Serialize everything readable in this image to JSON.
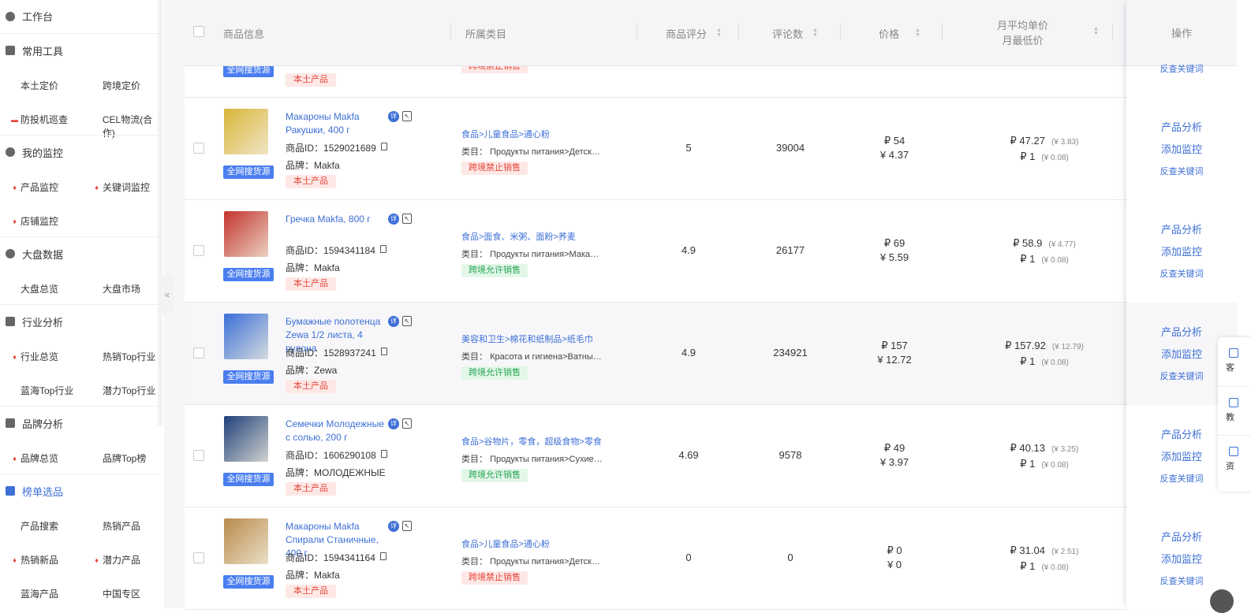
{
  "sidebar": {
    "sections": [
      {
        "label": "工作台",
        "icon": "home-icon",
        "subs": []
      },
      {
        "label": "常用工具",
        "icon": "grid-icon",
        "subs": [
          {
            "label": "本土定价",
            "hot": false
          },
          {
            "label": "跨境定价",
            "hot": false
          },
          {
            "label": "防投机巡查",
            "hot": false,
            "flag": true
          },
          {
            "label": "CEL物流(合作)",
            "hot": false
          }
        ]
      },
      {
        "label": "我的监控",
        "icon": "monitor-icon",
        "subs": [
          {
            "label": "产品监控",
            "hot": true
          },
          {
            "label": "关键词监控",
            "hot": true
          },
          {
            "label": "店铺监控",
            "hot": true
          }
        ]
      },
      {
        "label": "大盘数据",
        "icon": "pie-chart-icon",
        "subs": [
          {
            "label": "大盘总览",
            "hot": false
          },
          {
            "label": "大盘市场",
            "hot": false
          }
        ]
      },
      {
        "label": "行业分析",
        "icon": "bar-chart-icon",
        "subs": [
          {
            "label": "行业总览",
            "hot": true
          },
          {
            "label": "热销Top行业",
            "hot": false
          },
          {
            "label": "蓝海Top行业",
            "hot": false
          },
          {
            "label": "潜力Top行业",
            "hot": false
          }
        ]
      },
      {
        "label": "品牌分析",
        "icon": "brand-icon",
        "subs": [
          {
            "label": "品牌总览",
            "hot": true
          },
          {
            "label": "品牌Top榜",
            "hot": false
          }
        ]
      },
      {
        "label": "榜单选品",
        "icon": "ranking-icon",
        "active": true,
        "subs": [
          {
            "label": "产品搜索",
            "hot": false
          },
          {
            "label": "热销产品",
            "hot": false
          },
          {
            "label": "热销新品",
            "hot": true
          },
          {
            "label": "潜力产品",
            "hot": true
          },
          {
            "label": "蓝海产品",
            "hot": false
          },
          {
            "label": "中国专区",
            "hot": false
          }
        ]
      }
    ],
    "collapse_glyph": "«"
  },
  "table": {
    "headers": {
      "info": "商品信息",
      "category": "所属类目",
      "rating": "商品评分",
      "reviews": "评论数",
      "price": "价格",
      "monthly_line1": "月平均单价",
      "monthly_line2": "月最低价",
      "ops": "操作"
    },
    "partial": {
      "source": "全网搜货源",
      "local": "本土产品",
      "ship": "跨境禁止销售",
      "op": "反查关键词"
    },
    "rows": [
      {
        "name": "Макароны Makfa Ракушки, 400 г",
        "id_label": "商品ID：",
        "id": "1529021689",
        "brand_label": "品牌：",
        "brand": "Makfa",
        "source": "全网搜货源",
        "local": "本土产品",
        "cat_path": "食品>儿童食品>通心粉",
        "cat_label": "类目：",
        "cat_ru": "Продукты питания>Детское питание>Макароны",
        "ship": "跨境禁止销售",
        "ship_ok": false,
        "rating": "5",
        "reviews": "39004",
        "price_rub": "₽ 54",
        "price_cny": "¥ 4.37",
        "mavg_rub": "₽ 47.27",
        "mavg_cny": "(¥ 3.83)",
        "mmin_rub": "₽ 1",
        "mmin_cny": "(¥ 0.08)",
        "thumb_color": "#d9b43a"
      },
      {
        "name": "Гречка Makfa, 800 г",
        "id_label": "商品ID：",
        "id": "1594341184",
        "brand_label": "品牌：",
        "brand": "Makfa",
        "source": "全网搜货源",
        "local": "本土产品",
        "cat_path": "食品>面食、米粥、面粉>荞麦",
        "cat_label": "类目：",
        "cat_ru": "Продукты питания>Макароны, крупы",
        "ship": "跨境允许销售",
        "ship_ok": true,
        "rating": "4.9",
        "reviews": "26177",
        "price_rub": "₽ 69",
        "price_cny": "¥ 5.59",
        "mavg_rub": "₽ 58.9",
        "mavg_cny": "(¥ 4.77)",
        "mmin_rub": "₽ 1",
        "mmin_cny": "(¥ 0.08)",
        "thumb_color": "#c2332b"
      },
      {
        "name": "Бумажные полотенца Zewa 1/2 листа, 4 рулона",
        "id_label": "商品ID：",
        "id": "1528937241",
        "brand_label": "品牌：",
        "brand": "Zewa",
        "source": "全网搜货源",
        "local": "本土产品",
        "cat_path": "美容和卫生>棉花和纸制品>纸毛巾",
        "cat_label": "类目：",
        "cat_ru": "Красота и гигиена>Ватные изделия",
        "ship": "跨境允许销售",
        "ship_ok": true,
        "rating": "4.9",
        "reviews": "234921",
        "price_rub": "₽ 157",
        "price_cny": "¥ 12.72",
        "mavg_rub": "₽ 157.92",
        "mavg_cny": "(¥ 12.79)",
        "mmin_rub": "₽ 1",
        "mmin_cny": "(¥ 0.08)",
        "thumb_color": "#3b6fd8"
      },
      {
        "name": "Семечки Молодежные с солью, 200 г",
        "id_label": "商品ID：",
        "id": "1606290108",
        "brand_label": "品牌：",
        "brand": "МОЛОДЕЖНЫЕ",
        "source": "全网搜货源",
        "local": "本土产品",
        "cat_path": "食品>谷物片，零食，超级食物>零食",
        "cat_label": "类目：",
        "cat_ru": "Продукты питания>Сухие завтраки",
        "ship": "跨境允许销售",
        "ship_ok": true,
        "rating": "4.69",
        "reviews": "9578",
        "price_rub": "₽ 49",
        "price_cny": "¥ 3.97",
        "mavg_rub": "₽ 40.13",
        "mavg_cny": "(¥ 3.25)",
        "mmin_rub": "₽ 1",
        "mmin_cny": "(¥ 0.08)",
        "thumb_color": "#1f3f7a"
      },
      {
        "name": "Макароны Makfa Спирали Станичные, 400 г",
        "id_label": "商品ID：",
        "id": "1594341164",
        "brand_label": "品牌：",
        "brand": "Makfa",
        "source": "全网搜货源",
        "local": "本土产品",
        "cat_path": "食品>儿童食品>通心粉",
        "cat_label": "类目：",
        "cat_ru": "Продукты питания>Детское питание>Макароны",
        "ship": "跨境禁止销售",
        "ship_ok": false,
        "rating": "0",
        "reviews": "0",
        "price_rub": "₽ 0",
        "price_cny": "¥ 0",
        "mavg_rub": "₽ 31.04",
        "mavg_cny": "(¥ 2.51)",
        "mmin_rub": "₽ 1",
        "mmin_cny": "(¥ 0.08)",
        "thumb_color": "#b98a4b"
      }
    ],
    "ops": {
      "analyze": "产品分析",
      "monitor": "添加监控",
      "reverse": "反查关键词"
    },
    "badge_detail": "详"
  },
  "float_panel": [
    {
      "label": "客",
      "icon": "headset-icon"
    },
    {
      "label": "教",
      "icon": "video-icon"
    },
    {
      "label": "资",
      "icon": "doc-icon"
    }
  ]
}
